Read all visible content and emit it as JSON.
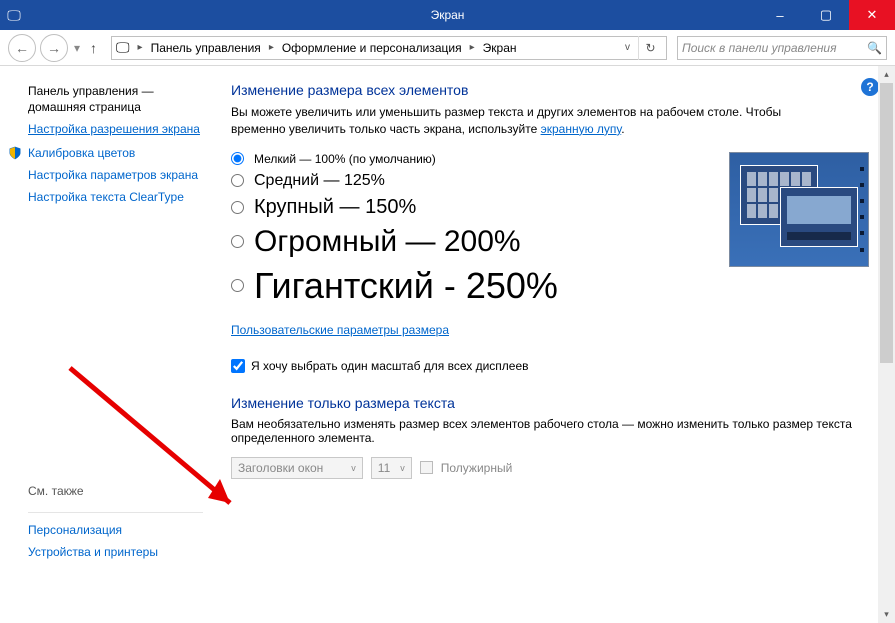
{
  "window": {
    "title": "Экран",
    "minimize": "–",
    "maximize": "▢",
    "close": "✕"
  },
  "breadcrumb": {
    "root": "Панель управления",
    "mid": "Оформление и персонализация",
    "leaf": "Экран"
  },
  "search": {
    "placeholder": "Поиск в панели управления"
  },
  "sidebar": {
    "heading1": "Панель управления —",
    "heading2": "домашняя страница",
    "link_resolution": "Настройка разрешения экрана",
    "link_calibration": "Калибровка цветов",
    "link_display_params": "Настройка параметров экрана",
    "link_cleartype": "Настройка текста ClearType",
    "see_also": "См. также",
    "link_personalization": "Персонализация",
    "link_devices": "Устройства и принтеры"
  },
  "main": {
    "section1_title": "Изменение размера всех элементов",
    "section1_desc_pre": "Вы можете увеличить или уменьшить размер текста и других элементов на рабочем столе. Чтобы временно увеличить только часть экрана, используйте ",
    "section1_desc_link": "экранную лупу",
    "section1_desc_post": ".",
    "sizes": [
      {
        "label": "Мелкий — 100% (по умолчанию)",
        "checked": true
      },
      {
        "label": "Средний — 125%",
        "checked": false
      },
      {
        "label": "Крупный — 150%",
        "checked": false
      },
      {
        "label": "Огромный — 200%",
        "checked": false
      },
      {
        "label": "Гигантский - 250%",
        "checked": false
      }
    ],
    "custom_link": "Пользовательские параметры размера",
    "checkbox_label": "Я хочу выбрать один масштаб для всех дисплеев",
    "section2_title": "Изменение только размера текста",
    "section2_desc": "Вам необязательно изменять размер всех элементов рабочего стола — можно изменить только размер текста определенного элемента.",
    "dropdown_element": "Заголовки окон",
    "dropdown_size": "11",
    "bold_label": "Полужирный"
  }
}
